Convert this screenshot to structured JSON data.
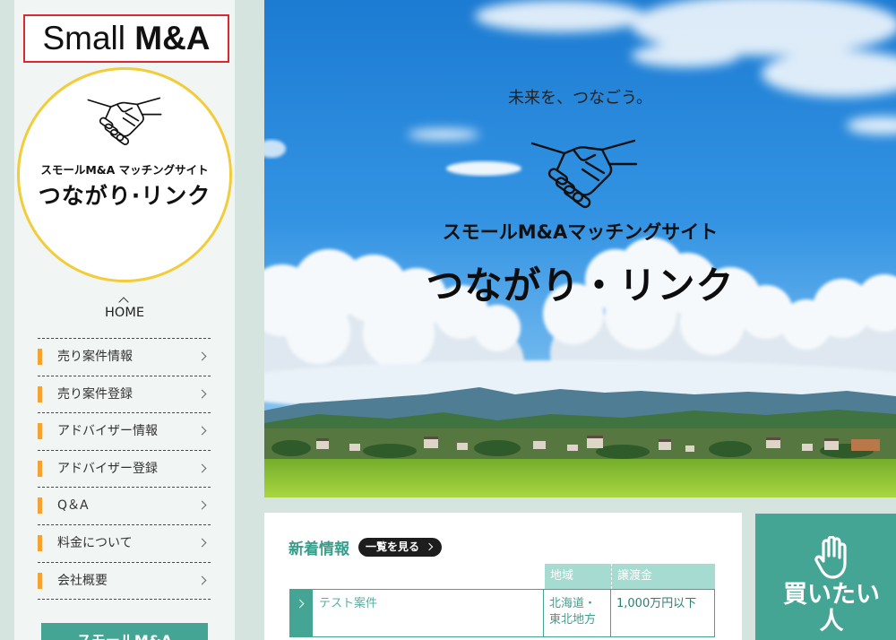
{
  "sidebar": {
    "brand": {
      "word1": "Small",
      "word2": "M&A"
    },
    "logo": {
      "tagline": "スモールM&A マッチングサイト",
      "name": "つながり·リンク"
    },
    "home_label": "HOME",
    "menu": [
      {
        "label": "売り案件情報"
      },
      {
        "label": "売り案件登録"
      },
      {
        "label": "アドバイザー情報"
      },
      {
        "label": "アドバイザー登録"
      },
      {
        "label": "Q＆A"
      },
      {
        "label": "料金について"
      },
      {
        "label": "会社概要"
      }
    ],
    "cta_label": "スモールM&A"
  },
  "hero": {
    "catchphrase": "未来を、つなごう。",
    "subtitle": "スモールM&Aマッチングサイト",
    "title": "つながり・リンク"
  },
  "news": {
    "heading": "新着情報",
    "view_all_label": "一覧を見る",
    "columns": {
      "region": "地域",
      "price": "譲渡金"
    },
    "rows": [
      {
        "title": "テスト案件",
        "region": "北海道・東北地方",
        "price": "1,000万円以下"
      }
    ]
  },
  "buyer_card": {
    "label": "買いたい人"
  },
  "icons": {
    "brand_mark": "handshake-icon",
    "home_marker": "chevron-up-icon",
    "menu_arrow": "chevron-right-icon",
    "buyer": "raised-hand-icon"
  },
  "colors": {
    "teal": "#45a594",
    "orange": "#f4a232",
    "brand_border": "#d9282f",
    "logo_ring": "#f3cc3a",
    "header_mint": "#a5dbd0"
  }
}
